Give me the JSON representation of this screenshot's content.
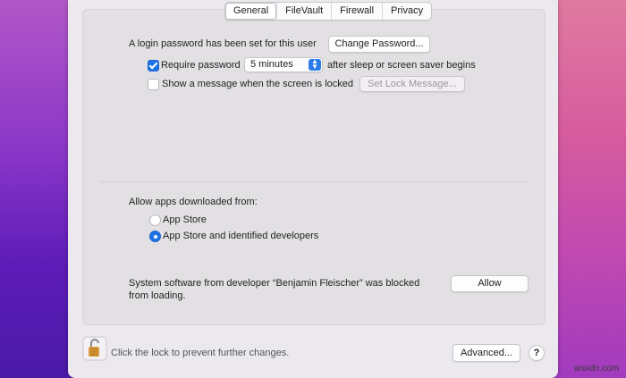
{
  "tabs": [
    "General",
    "FileVault",
    "Firewall",
    "Privacy"
  ],
  "general": {
    "login_text": "A login password has been set for this user",
    "change_password": "Change Password...",
    "require_password_label": "Require password",
    "require_password_checked": true,
    "delay_value": "5 minutes",
    "after_sleep_text": "after sleep or screen saver begins",
    "show_message_label": "Show a message when the screen is locked",
    "show_message_checked": false,
    "set_lock_message": "Set Lock Message..."
  },
  "allow_apps": {
    "heading": "Allow apps downloaded from:",
    "options": [
      "App Store",
      "App Store and identified developers"
    ],
    "selected": "App Store and identified developers"
  },
  "blocked": {
    "line1": "System software from developer “Benjamin Fleischer” was blocked",
    "line2": "from loading.",
    "allow_button": "Allow"
  },
  "footer": {
    "lock_text": "Click the lock to prevent further changes.",
    "advanced_button": "Advanced...",
    "help": "?"
  },
  "watermark": "wsxdn.com",
  "colors": {
    "accent": "#1e73e6"
  }
}
